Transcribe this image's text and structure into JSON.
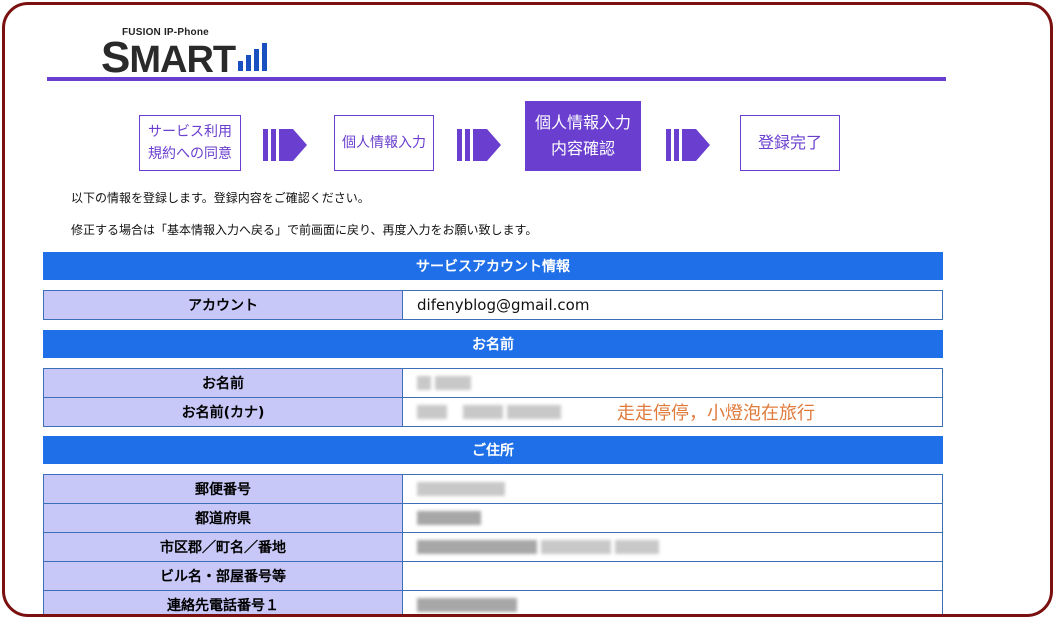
{
  "logo": {
    "subtitle": "FUSION IP-Phone",
    "title_first": "S",
    "title_rest": "MART"
  },
  "steps": [
    {
      "label": "サービス利用\n規約への同意",
      "active": false
    },
    {
      "label": "個人情報入力",
      "active": false
    },
    {
      "label": "個人情報入力\n内容確認",
      "active": true
    },
    {
      "label": "登録完了",
      "active": false
    }
  ],
  "messages": {
    "line1": "以下の情報を登録します。登録内容をご確認ください。",
    "line2": "修正する場合は「基本情報入力へ戻る」で前画面に戻り、再度入力をお願い致します。"
  },
  "sections": {
    "account": {
      "title": "サービスアカウント情報",
      "rows": [
        {
          "label": "アカウント",
          "value": "difenyblog@gmail.com"
        }
      ]
    },
    "name": {
      "title": "お名前",
      "rows": [
        {
          "label": "お名前",
          "value": ""
        },
        {
          "label": "お名前(カナ)",
          "value": ""
        }
      ]
    },
    "address": {
      "title": "ご住所",
      "rows": [
        {
          "label": "郵便番号",
          "value": ""
        },
        {
          "label": "都道府県",
          "value": ""
        },
        {
          "label": "市区郡／町名／番地",
          "value": ""
        },
        {
          "label": "ビル名・部屋番号等",
          "value": ""
        },
        {
          "label": "連絡先電話番号１",
          "value": ""
        }
      ]
    }
  },
  "watermark": "走走停停，小燈泡在旅行",
  "colors": {
    "accent": "#6a3fcf",
    "header_blue": "#1e6fe8",
    "label_bg": "#c8c8f8",
    "frame": "#7a1010"
  }
}
